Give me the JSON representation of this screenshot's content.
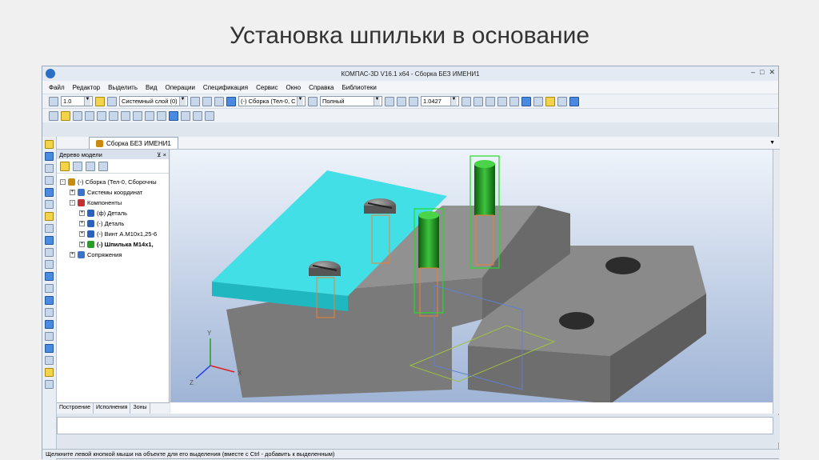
{
  "slide": {
    "title": "Установка шпильки в основание"
  },
  "window": {
    "title": "КОМПАС-3D V16.1 x64 - Сборка БЕЗ ИМЕНИ1"
  },
  "menu": [
    "Файл",
    "Редактор",
    "Выделить",
    "Вид",
    "Операции",
    "Спецификация",
    "Сервис",
    "Окно",
    "Справка",
    "Библиотеки"
  ],
  "toolbar": {
    "step_value": "1.0",
    "layer_value": "Системный слой (0)",
    "assembly_value": "(-) Сборка (Тел-0, С",
    "view_mode": "Полный",
    "zoom_value": "1.0427"
  },
  "document_tab": {
    "label": "Сборка БЕЗ ИМЕНИ1"
  },
  "tree_panel": {
    "header": "Дерево модели",
    "pin": "⊻ ×",
    "items": [
      {
        "level": 0,
        "expander": "-",
        "label": "(-) Сборка (Тел-0, Сборочны",
        "bold": false,
        "color": "#c98a10"
      },
      {
        "level": 1,
        "expander": "+",
        "label": "Системы координат",
        "bold": false,
        "color": "#3a73c9"
      },
      {
        "level": 1,
        "expander": "-",
        "label": "Компоненты",
        "bold": false,
        "color": "#c43030"
      },
      {
        "level": 2,
        "expander": "+",
        "label": "(ф) Деталь",
        "bold": false,
        "color": "#2a62c0"
      },
      {
        "level": 2,
        "expander": "+",
        "label": "(-) Деталь",
        "bold": false,
        "color": "#2a62c0"
      },
      {
        "level": 2,
        "expander": "+",
        "label": "(-) Винт А.М10x1,25-6",
        "bold": false,
        "color": "#2a62c0"
      },
      {
        "level": 2,
        "expander": "+",
        "label": "(-) Шпилька М14x1,",
        "bold": true,
        "color": "#25a025"
      },
      {
        "level": 1,
        "expander": "+",
        "label": "Сопряжения",
        "bold": false,
        "color": "#3a73c9"
      }
    ],
    "tabs": [
      "Построение",
      "Исполнения",
      "Зоны"
    ]
  },
  "axes": {
    "x": "X",
    "y": "Y",
    "z": "Z"
  },
  "status": {
    "text": "Щелкните левой кнопкой мыши на объекте для его выделения (вместе с Ctrl - добавить к выделенным)"
  },
  "colors": {
    "plate": "#40e0e8",
    "base": "#808080",
    "stud": "#1e9a1e",
    "viewport_bg": "#b8c8e0"
  }
}
